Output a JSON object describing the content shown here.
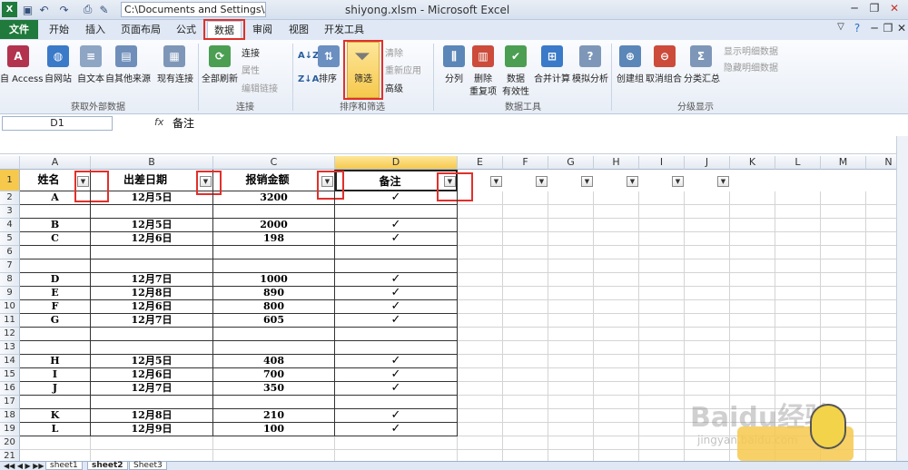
{
  "titlebar": {
    "path": "C:\\Documents and Settings\\Adı",
    "title": "shiyong.xlsm - Microsoft Excel"
  },
  "tabs": {
    "file": "文件",
    "home": "开始",
    "insert": "插入",
    "layout": "页面布局",
    "formulas": "公式",
    "data": "数据",
    "review": "审阅",
    "view": "视图",
    "dev": "开发工具"
  },
  "ribbon": {
    "external": {
      "access": "自 Access",
      "web": "自网站",
      "text": "自文本",
      "other": "自其他来源",
      "existing": "现有连接",
      "group": "获取外部数据"
    },
    "connections": {
      "refresh": "全部刷新",
      "connect": "连接",
      "props": "属性",
      "editlinks": "编辑链接",
      "group": "连接"
    },
    "sort": {
      "sort": "排序",
      "filter": "筛选",
      "clear": "清除",
      "reapply": "重新应用",
      "advanced": "高级",
      "group": "排序和筛选"
    },
    "tools": {
      "split": "分列",
      "dedup_1": "删除",
      "dedup_2": "重复项",
      "validate_1": "数据",
      "validate_2": "有效性",
      "consolidate": "合并计算",
      "whatif": "模拟分析",
      "group": "数据工具"
    },
    "outline": {
      "groupbtn": "创建组",
      "ungroup": "取消组合",
      "subtotal": "分类汇总",
      "show": "显示明细数据",
      "hide": "隐藏明细数据",
      "group": "分级显示"
    }
  },
  "formula": {
    "namebox": "D1",
    "fx": "fx",
    "value": "备注"
  },
  "columns": [
    "A",
    "B",
    "C",
    "D",
    "E",
    "F",
    "G",
    "H",
    "I",
    "J",
    "K",
    "L",
    "M",
    "N"
  ],
  "headers": {
    "name": "姓名",
    "date": "出差日期",
    "amount": "报销金额",
    "note": "备注"
  },
  "rows": [
    {
      "n": "2",
      "a": "A",
      "b": "12月5日",
      "c": "3200",
      "d": "✓"
    },
    {
      "n": "3",
      "a": "",
      "b": "",
      "c": "",
      "d": ""
    },
    {
      "n": "4",
      "a": "B",
      "b": "12月5日",
      "c": "2000",
      "d": "✓"
    },
    {
      "n": "5",
      "a": "C",
      "b": "12月6日",
      "c": "198",
      "d": "✓"
    },
    {
      "n": "6",
      "a": "",
      "b": "",
      "c": "",
      "d": ""
    },
    {
      "n": "7",
      "a": "",
      "b": "",
      "c": "",
      "d": ""
    },
    {
      "n": "8",
      "a": "D",
      "b": "12月7日",
      "c": "1000",
      "d": "✓"
    },
    {
      "n": "9",
      "a": "E",
      "b": "12月8日",
      "c": "890",
      "d": "✓"
    },
    {
      "n": "10",
      "a": "F",
      "b": "12月6日",
      "c": "800",
      "d": "✓"
    },
    {
      "n": "11",
      "a": "G",
      "b": "12月7日",
      "c": "605",
      "d": "✓"
    },
    {
      "n": "12",
      "a": "",
      "b": "",
      "c": "",
      "d": ""
    },
    {
      "n": "13",
      "a": "",
      "b": "",
      "c": "",
      "d": ""
    },
    {
      "n": "14",
      "a": "H",
      "b": "12月5日",
      "c": "408",
      "d": "✓"
    },
    {
      "n": "15",
      "a": "I",
      "b": "12月6日",
      "c": "700",
      "d": "✓"
    },
    {
      "n": "16",
      "a": "J",
      "b": "12月7日",
      "c": "350",
      "d": "✓"
    },
    {
      "n": "17",
      "a": "",
      "b": "",
      "c": "",
      "d": ""
    },
    {
      "n": "18",
      "a": "K",
      "b": "12月8日",
      "c": "210",
      "d": "✓"
    },
    {
      "n": "19",
      "a": "L",
      "b": "12月9日",
      "c": "100",
      "d": "✓"
    },
    {
      "n": "20",
      "a": "",
      "b": "",
      "c": "",
      "d": ""
    },
    {
      "n": "21",
      "a": "",
      "b": "",
      "c": "",
      "d": ""
    }
  ],
  "row1": "1",
  "sheets": [
    "sheet1",
    "sheet2",
    "Sheet3"
  ],
  "watermark": {
    "brand": "Baidu经验",
    "url": "jingyan.baidu.com"
  },
  "colors": {
    "highlight": "#e0302b",
    "file_tab": "#1f7a3c",
    "filter_active": "#f6c94d"
  }
}
